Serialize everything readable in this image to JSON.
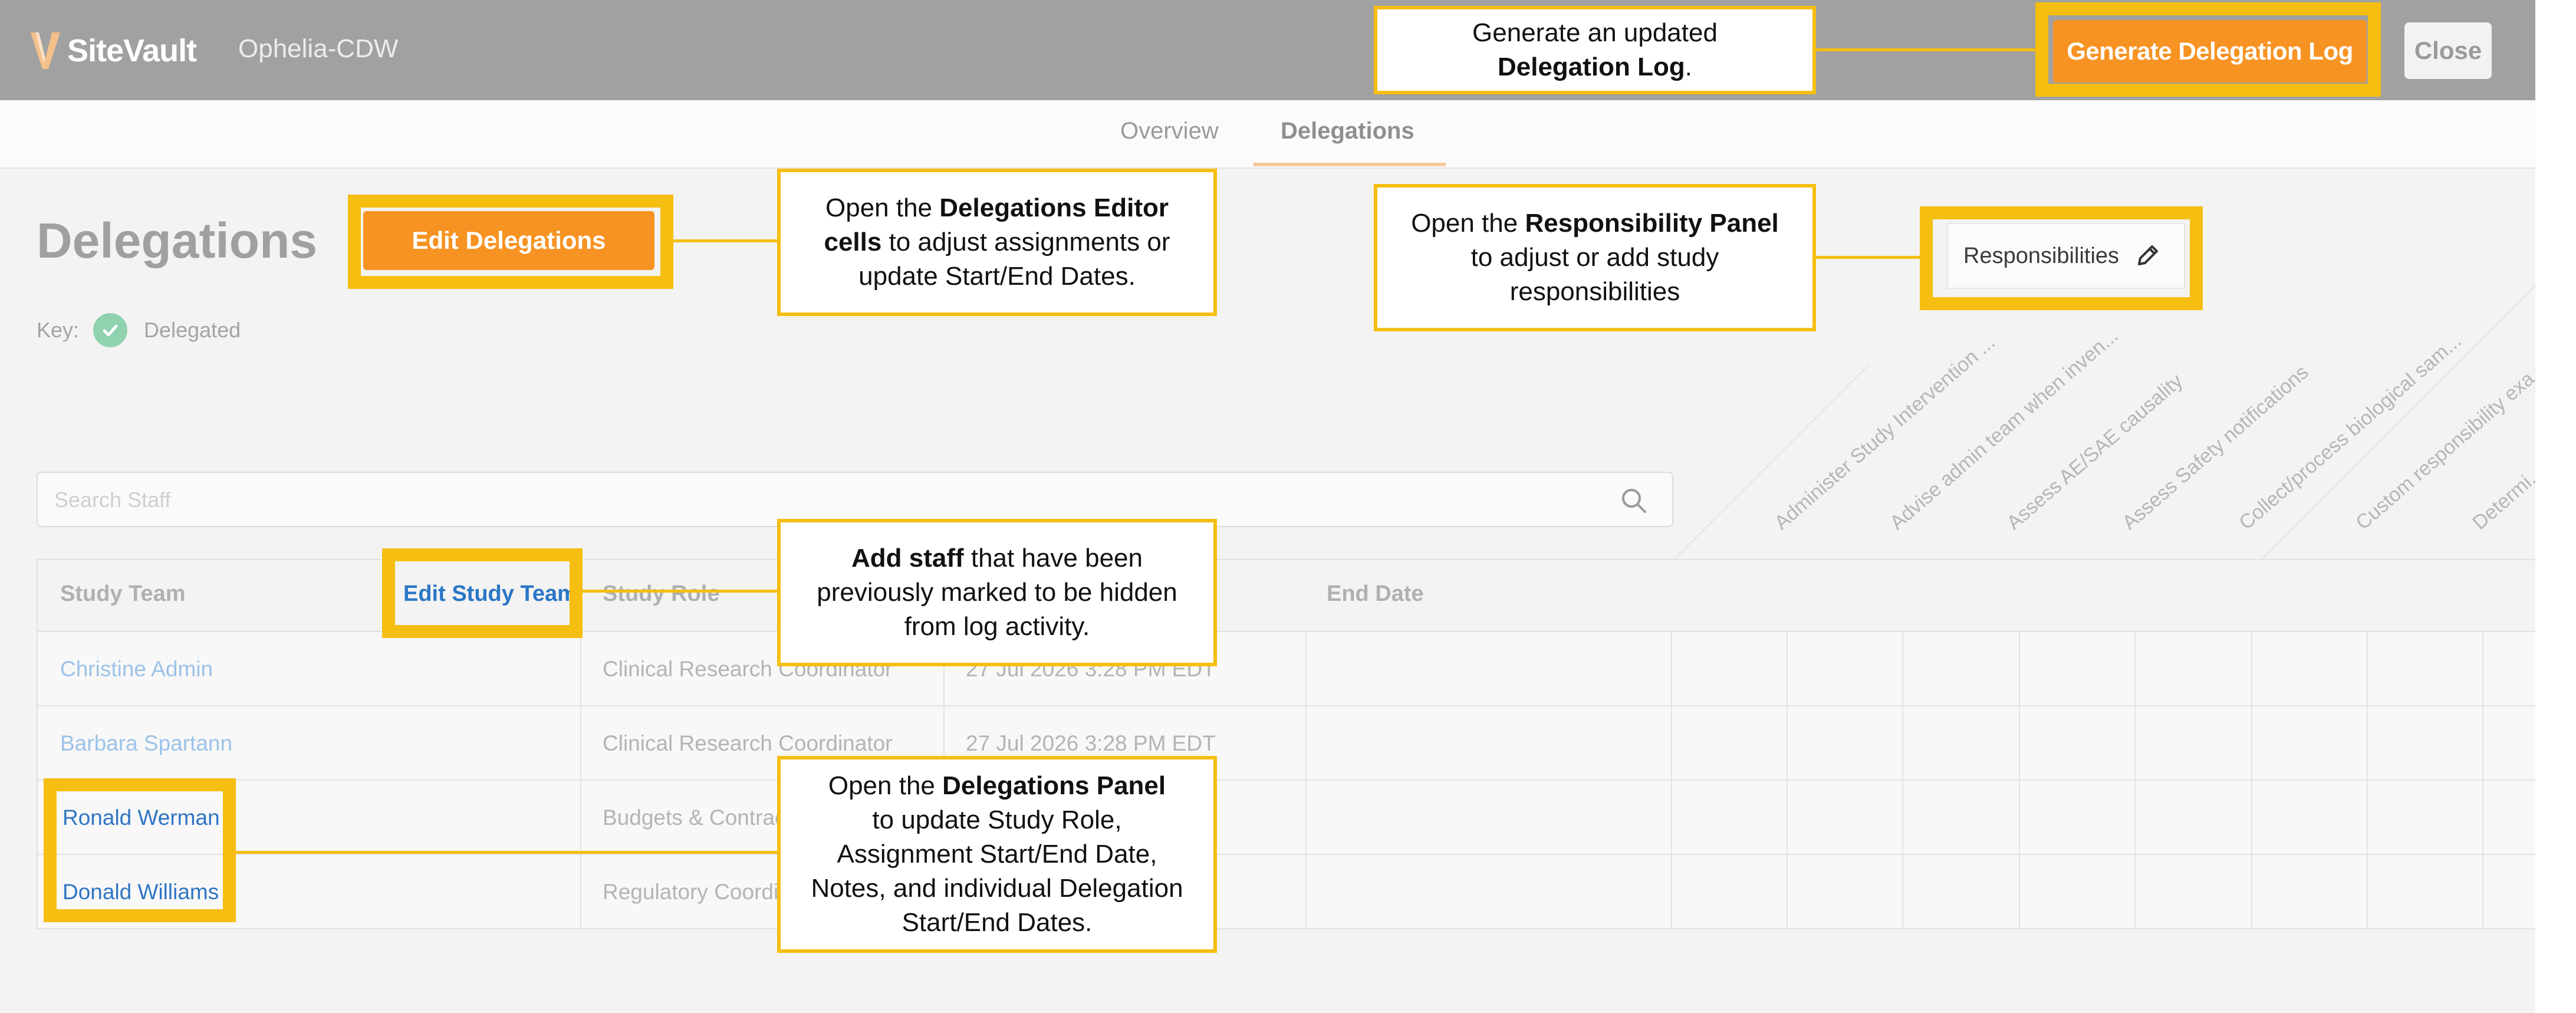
{
  "app": {
    "brand": "SiteVault",
    "study_name": "Ophelia-CDW"
  },
  "header": {
    "generate_label": "Generate Delegation Log",
    "close_label": "Close"
  },
  "tabs": [
    {
      "label": "Overview"
    },
    {
      "label": "Delegations"
    }
  ],
  "page": {
    "title": "Delegations",
    "edit_delegations_label": "Edit Delegations",
    "key_label": "Key:",
    "key_delegated": "Delegated",
    "search_placeholder": "Search Staff",
    "responsibilities_label": "Responsibilities"
  },
  "responsibility_columns": [
    "Administer Study Intervention ...",
    "Advise admin team when inven...",
    "Assess AE/SAE causality",
    "Assess Safety notifications",
    "Collect/process biological sam...",
    "Custom responsibility exa...",
    "Determi..."
  ],
  "table": {
    "headers": {
      "team": "Study Team",
      "edit_team": "Edit Study Team",
      "role": "Study Role",
      "end": "End Date"
    },
    "rows": [
      {
        "name": "Christine Admin",
        "role": "Clinical Research Coordinator",
        "start": "27 Jul 2026 3:28 PM EDT",
        "end": ""
      },
      {
        "name": "Barbara Spartann",
        "role": "Clinical Research Coordinator",
        "start": "27 Jul 2026 3:28 PM EDT",
        "end": ""
      },
      {
        "name": "Ronald Werman",
        "role": "Budgets & Contrac",
        "start": "",
        "end": ""
      },
      {
        "name": "Donald Williams",
        "role": "Regulatory Coordi",
        "start": "",
        "end": ""
      }
    ]
  },
  "callouts": {
    "generate": {
      "l1": "Generate an updated",
      "b1": "Delegation Log",
      "e1": "."
    },
    "edit_deleg": {
      "p1": "Open the ",
      "b1": "Delegations Editor",
      "b2": "cells",
      "p2": " to adjust assignments or",
      "l3": "update Start/End Dates."
    },
    "resp": {
      "p1": "Open the ",
      "b1": "Responsibility Panel",
      "l2": "to adjust or add study",
      "l3": "responsibilities"
    },
    "staff": {
      "b1": "Add staff",
      "p1": " that have been",
      "l2": "previously marked to be hidden",
      "l3": "from log activity."
    },
    "panel": {
      "p1": "Open the ",
      "b1": "Delegations Panel",
      "l2": "to update Study Role,",
      "l3": "Assignment Start/End Date,",
      "l4": "Notes, and individual Delegation",
      "l5": "Start/End Dates."
    }
  },
  "colors": {
    "accent": "#F79323",
    "highlight": "#F5BE10",
    "link": "#2F75C4"
  }
}
